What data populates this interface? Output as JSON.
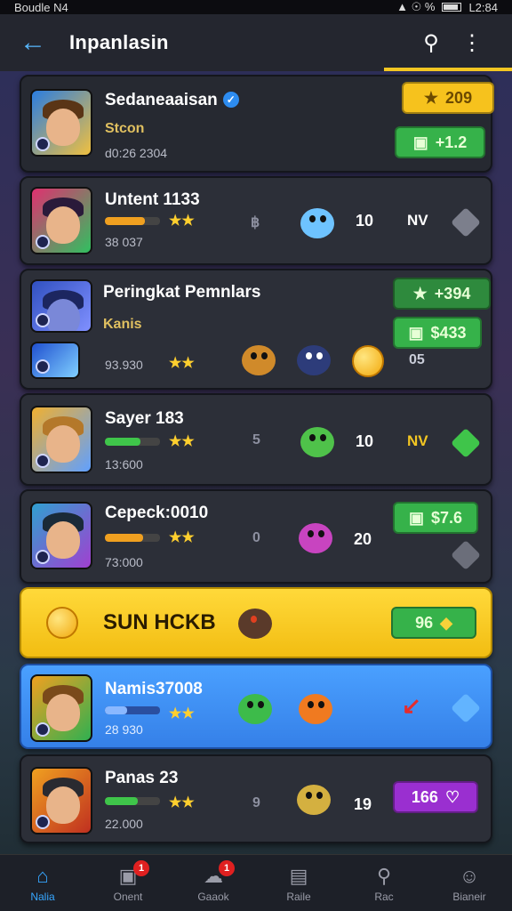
{
  "status": {
    "carrier": "Boudle N4",
    "signal": "▲ ☉ %",
    "time": "L2:84"
  },
  "appbar": {
    "title": "Inpanlasin",
    "back_icon": "←",
    "search_icon": "⚲",
    "more_icon": "⋮"
  },
  "players": [
    {
      "name": "Sedaneaaisan",
      "subtitle": "Stcon",
      "score": "d0:26 2304",
      "pills": [
        {
          "icon": "★",
          "value": "209",
          "style": "yellow"
        },
        {
          "icon": "▣",
          "value": "+1.2",
          "style": "green"
        }
      ]
    },
    {
      "name": "Untent 1133",
      "stars": "★★",
      "score": "38 037",
      "mid": "฿",
      "count": "10",
      "tag": "NV",
      "bar_fill": 0.72,
      "bar_color": "#f0a020",
      "gem_color": "#7c7f8c"
    },
    {
      "name": "Peringkat Pemnlars",
      "subtitle": "Kanis",
      "stars": "★★",
      "score": "93.930",
      "pills": [
        {
          "icon": "★",
          "value": "+394",
          "style": "green"
        },
        {
          "icon": "▣",
          "value": "$433",
          "style": "green"
        }
      ],
      "extra": "05"
    },
    {
      "name": "Sayer 183",
      "stars": "★★",
      "score": "13:600",
      "mid": "5",
      "count": "10",
      "tag": "NV",
      "bar_fill": 0.65,
      "bar_color": "#3fc54a",
      "gem_color": "#3fc54a"
    },
    {
      "name": "Cepeck:0010",
      "stars": "★★",
      "score": "73:000",
      "mid": "0",
      "count": "20",
      "bar_fill": 0.7,
      "bar_color": "#f0a020",
      "gem_color": "#6b6e7a",
      "pills": [
        {
          "icon": "▣",
          "value": "$7.6",
          "style": "green"
        }
      ]
    },
    {
      "name": "SUN HCKB",
      "pills": [
        {
          "icon": "◆",
          "value": "96",
          "style": "green"
        }
      ]
    },
    {
      "name": "Namis37008",
      "stars": "★★",
      "score": "28 930",
      "gem_color": "#62b4ff"
    },
    {
      "name": "Panas 23",
      "stars": "★★",
      "score": "22.000",
      "mid": "9",
      "count": "19",
      "bar_fill": 0.6,
      "bar_color": "#3fc54a",
      "pills": [
        {
          "icon": "♡",
          "value": "166",
          "style": "purple"
        }
      ]
    }
  ],
  "bottom_nav": [
    {
      "label": "Nalia",
      "icon": "⌂",
      "active": true
    },
    {
      "label": "Onent",
      "icon": "▣",
      "badge": "1"
    },
    {
      "label": "Gaaok",
      "icon": "☁",
      "badge": "1"
    },
    {
      "label": "Raile",
      "icon": "▤"
    },
    {
      "label": "Rac",
      "icon": "⚲"
    },
    {
      "label": "Bianeir",
      "icon": "☺"
    }
  ],
  "colors": {
    "accent": "#f3c622",
    "active_nav": "#36a6ff",
    "card_bg": "#2c2f38"
  }
}
